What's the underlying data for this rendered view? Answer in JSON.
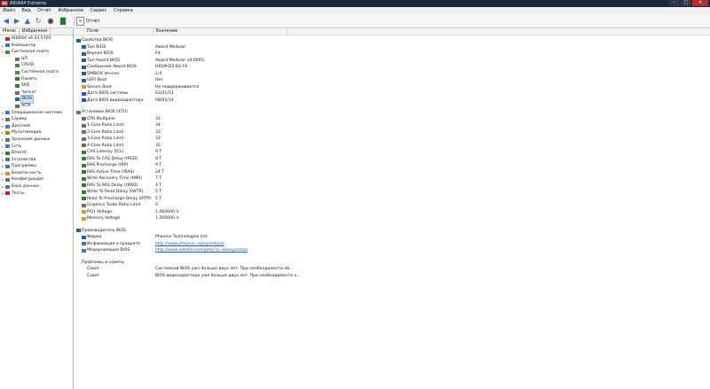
{
  "window": {
    "title": "AIDA64 Extreme",
    "app_icon": "64"
  },
  "menu": [
    "Файл",
    "Вид",
    "Отчёт",
    "Избранное",
    "Сервис",
    "Справка"
  ],
  "toolbar": {
    "report_label": "Отчёт"
  },
  "tabs": [
    "Меню",
    "Избранное"
  ],
  "tree": [
    {
      "label": "AIDA64 v6.33.5700",
      "level": 0,
      "expand": "",
      "icon": "#c8202a"
    },
    {
      "label": "Компьютер",
      "level": 0,
      "expand": "▸",
      "icon": "#3a78c8"
    },
    {
      "label": "Системная плата",
      "level": 0,
      "expand": "▾",
      "icon": "#3f8f3f"
    },
    {
      "label": "ЦП",
      "level": 1,
      "expand": "",
      "icon": "#6d6d6d"
    },
    {
      "label": "CPUID",
      "level": 1,
      "expand": "",
      "icon": "#6d6d6d"
    },
    {
      "label": "Системная плата",
      "level": 1,
      "expand": "",
      "icon": "#3f8f3f"
    },
    {
      "label": "Память",
      "level": 1,
      "expand": "",
      "icon": "#2f7f2f"
    },
    {
      "label": "SPD",
      "level": 1,
      "expand": "",
      "icon": "#2f7f2f"
    },
    {
      "label": "Чипсет",
      "level": 1,
      "expand": "",
      "icon": "#6d6d6d"
    },
    {
      "label": "BIOS",
      "level": 1,
      "expand": "",
      "icon": "#2a5aa8",
      "selected": true
    },
    {
      "label": "ACPI",
      "level": 1,
      "expand": "",
      "icon": "#6d6d6d"
    },
    {
      "label": "Операционная система",
      "level": 0,
      "expand": "▸",
      "icon": "#3a78c8"
    },
    {
      "label": "Сервер",
      "level": 0,
      "expand": "▸",
      "icon": "#6d6d6d"
    },
    {
      "label": "Дисплей",
      "level": 0,
      "expand": "▸",
      "icon": "#3a78c8"
    },
    {
      "label": "Мультимедиа",
      "level": 0,
      "expand": "▸",
      "icon": "#c07a20"
    },
    {
      "label": "Хранение данных",
      "level": 0,
      "expand": "▸",
      "icon": "#6d6d6d"
    },
    {
      "label": "Сеть",
      "level": 0,
      "expand": "▸",
      "icon": "#3a78c8"
    },
    {
      "label": "DirectX",
      "level": 0,
      "expand": "▸",
      "icon": "#2f7f2f"
    },
    {
      "label": "Устройства",
      "level": 0,
      "expand": "▸",
      "icon": "#6d6d6d"
    },
    {
      "label": "Программы",
      "level": 0,
      "expand": "▸",
      "icon": "#3a78c8"
    },
    {
      "label": "Безопасность",
      "level": 0,
      "expand": "▸",
      "icon": "#c8a020"
    },
    {
      "label": "Конфигурация",
      "level": 0,
      "expand": "▸",
      "icon": "#6d6d6d"
    },
    {
      "label": "База данных",
      "level": 0,
      "expand": "▸",
      "icon": "#3a78c8"
    },
    {
      "label": "Тесты",
      "level": 0,
      "expand": "▸",
      "icon": "#c8202a"
    }
  ],
  "columns": {
    "field": "Поле",
    "value": "Значение"
  },
  "rows": [
    {
      "kind": "sec",
      "field": "Свойства BIOS",
      "icon": "#2a5aa8"
    },
    {
      "kind": "item",
      "field": "Тип BIOS",
      "value": "Award Modular",
      "icon": "#2a5aa8"
    },
    {
      "kind": "item",
      "field": "Версия BIOS",
      "value": "F4",
      "icon": "#2a5aa8"
    },
    {
      "kind": "item",
      "field": "Тип Award BIOS",
      "value": "Award Modular v6.00PG",
      "icon": "#2a5aa8"
    },
    {
      "kind": "item",
      "field": "Сообщение Award BIOS",
      "value": "H61M-D2-B3 F4",
      "icon": "#2a5aa8"
    },
    {
      "kind": "item",
      "field": "SMBIOS Version",
      "value": "2.4",
      "icon": "#2a5aa8"
    },
    {
      "kind": "item",
      "field": "UEFI Boot",
      "value": "Нет",
      "icon": "#2a5aa8"
    },
    {
      "kind": "item",
      "field": "Secure Boot",
      "value": "Не поддерживается",
      "icon": "#c8a020"
    },
    {
      "kind": "item",
      "field": "Дата BIOS системы",
      "value": "03/31/11",
      "icon": "#2a5aa8"
    },
    {
      "kind": "item",
      "field": "Дата BIOS видеоадаптера",
      "value": "08/01/14",
      "icon": "#2a5aa8"
    },
    {
      "kind": "gap"
    },
    {
      "kind": "sec",
      "field": "Установки BIOS (XTU)",
      "icon": "#6d6d6d"
    },
    {
      "kind": "item",
      "field": "CPU Multiplier",
      "value": "31",
      "icon": "#6d6d6d"
    },
    {
      "kind": "item",
      "field": "1-Core Ratio Limit",
      "value": "34",
      "icon": "#6d6d6d"
    },
    {
      "kind": "item",
      "field": "2-Core Ratio Limit",
      "value": "33",
      "icon": "#6d6d6d"
    },
    {
      "kind": "item",
      "field": "3-Core Ratio Limit",
      "value": "33",
      "icon": "#6d6d6d"
    },
    {
      "kind": "item",
      "field": "4-Core Ratio Limit",
      "value": "32",
      "icon": "#6d6d6d"
    },
    {
      "kind": "item",
      "field": "CAS Latency (tCL)",
      "value": "9 T",
      "icon": "#2f7f2f"
    },
    {
      "kind": "item",
      "field": "RAS To CAS Delay (tRCD)",
      "value": "9 T",
      "icon": "#2f7f2f"
    },
    {
      "kind": "item",
      "field": "RAS Precharge (tRP)",
      "value": "9 T",
      "icon": "#2f7f2f"
    },
    {
      "kind": "item",
      "field": "RAS Active Time (tRAS)",
      "value": "24 T",
      "icon": "#2f7f2f"
    },
    {
      "kind": "item",
      "field": "Write Recovery Time (tWR)",
      "value": "7 T",
      "icon": "#2f7f2f"
    },
    {
      "kind": "item",
      "field": "RAS To RAS Delay (tRRD)",
      "value": "4 T",
      "icon": "#2f7f2f"
    },
    {
      "kind": "item",
      "field": "Write To Read Delay (tWTR)",
      "value": "5 T",
      "icon": "#2f7f2f"
    },
    {
      "kind": "item",
      "field": "Read To Precharge Delay (tRTP)",
      "value": "5 T",
      "icon": "#2f7f2f"
    },
    {
      "kind": "item",
      "field": "Graphics Turbo Ratio Limit",
      "value": "0",
      "icon": "#6d6d6d"
    },
    {
      "kind": "item",
      "field": "PCH Voltage",
      "value": "1.060000 V",
      "icon": "#c8a020"
    },
    {
      "kind": "item",
      "field": "Memory Voltage",
      "value": "1.500000 V",
      "icon": "#c8a020"
    },
    {
      "kind": "gap"
    },
    {
      "kind": "sec",
      "field": "Производитель BIOS",
      "icon": "#2a5aa8"
    },
    {
      "kind": "item",
      "field": "Фирма",
      "value": "Phoenix Technologies Ltd.",
      "icon": "#2a5aa8"
    },
    {
      "kind": "item",
      "field": "Информация о продукте",
      "value": "http://www.phoenix.com/products",
      "link": true,
      "icon": "#3a78c8"
    },
    {
      "kind": "item",
      "field": "Модернизация BIOS",
      "value": "http://www.aida64.com/goto/?p=biosupdates",
      "link": true,
      "icon": "#3a78c8"
    },
    {
      "kind": "gap"
    },
    {
      "kind": "plain",
      "field": "Проблемы и советы",
      "indent": 9
    },
    {
      "kind": "plain",
      "field": "Совет",
      "value": "Системной BIOS уже больше двух лет. При необходимости об...",
      "indent": 15
    },
    {
      "kind": "plain",
      "field": "Совет",
      "value": "BIOS видеоадаптера уже больше двух лет. При необходимости о...",
      "indent": 15
    }
  ]
}
